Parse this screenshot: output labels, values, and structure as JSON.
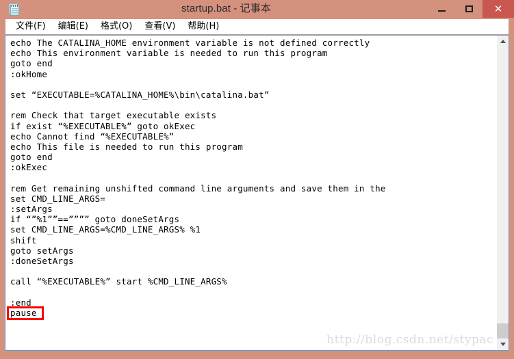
{
  "window": {
    "title": "startup.bat - 记事本",
    "app_icon": "notepad-icon",
    "frame_color": "#d4917e",
    "close_button_color": "#c9564f"
  },
  "window_controls": {
    "minimize": "—",
    "maximize": "□",
    "close": "✕"
  },
  "menubar": {
    "items": [
      {
        "label": "文件(F)"
      },
      {
        "label": "编辑(E)"
      },
      {
        "label": "格式(O)"
      },
      {
        "label": "查看(V)"
      },
      {
        "label": "帮助(H)"
      }
    ]
  },
  "editor": {
    "lines": [
      "echo The CATALINA_HOME environment variable is not defined correctly",
      "echo This environment variable is needed to run this program",
      "goto end",
      ":okHome",
      "",
      "set “EXECUTABLE=%CATALINA_HOME%\\bin\\catalina.bat”",
      "",
      "rem Check that target executable exists",
      "if exist “%EXECUTABLE%” goto okExec",
      "echo Cannot find “%EXECUTABLE%”",
      "echo This file is needed to run this program",
      "goto end",
      ":okExec",
      "",
      "rem Get remaining unshifted command line arguments and save them in the",
      "set CMD_LINE_ARGS=",
      ":setArgs",
      "if “”%1””==”””” goto doneSetArgs",
      "set CMD_LINE_ARGS=%CMD_LINE_ARGS% %1",
      "shift",
      "goto setArgs",
      ":doneSetArgs",
      "",
      "call “%EXECUTABLE%” start %CMD_LINE_ARGS%",
      "",
      ":end"
    ],
    "highlighted_line": "pause",
    "highlight_color": "#ff0000"
  },
  "watermark": {
    "text": "http://blog.csdn.net/stypac"
  },
  "scrollbar": {
    "up_arrow": "scroll-up",
    "down_arrow": "scroll-down"
  }
}
